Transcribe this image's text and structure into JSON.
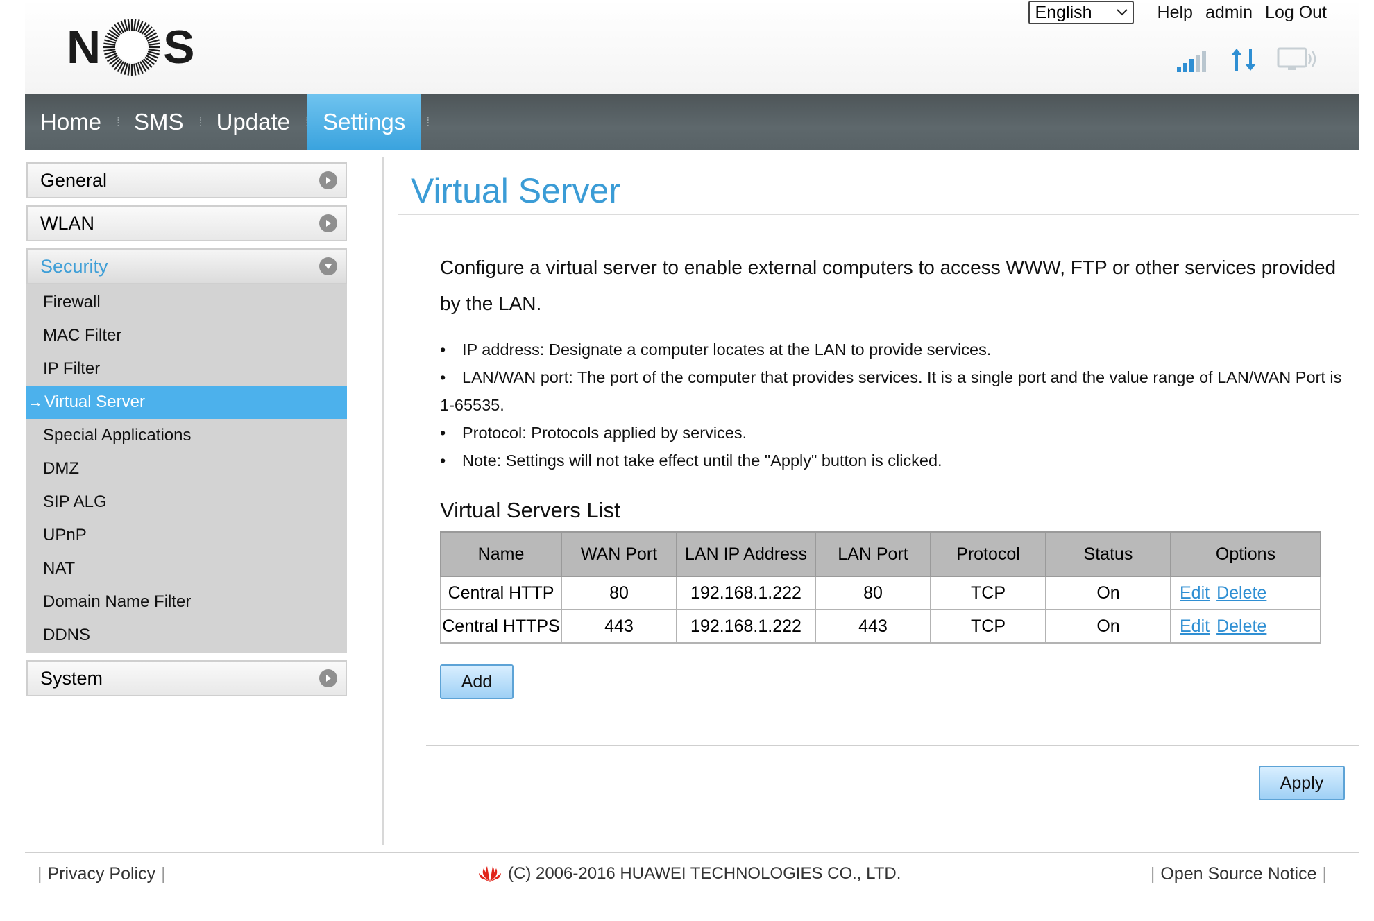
{
  "header": {
    "logo_text_left": "N",
    "logo_text_right": "S",
    "language": "English",
    "links": [
      "Help",
      "admin",
      "Log Out"
    ],
    "status_icons": [
      "signal-strength-icon",
      "data-transfer-icon",
      "pc-connection-icon"
    ]
  },
  "nav": {
    "items": [
      {
        "label": "Home",
        "active": false
      },
      {
        "label": "SMS",
        "active": false
      },
      {
        "label": "Update",
        "active": false
      },
      {
        "label": "Settings",
        "active": true
      }
    ]
  },
  "sidebar": {
    "general": "General",
    "wlan": "WLAN",
    "security": "Security",
    "system": "System",
    "security_items": [
      {
        "label": "Firewall",
        "active": false
      },
      {
        "label": "MAC Filter",
        "active": false
      },
      {
        "label": "IP Filter",
        "active": false
      },
      {
        "label": "Virtual Server",
        "active": true
      },
      {
        "label": "Special Applications",
        "active": false
      },
      {
        "label": "DMZ",
        "active": false
      },
      {
        "label": "SIP ALG",
        "active": false
      },
      {
        "label": "UPnP",
        "active": false
      },
      {
        "label": "NAT",
        "active": false
      },
      {
        "label": "Domain Name Filter",
        "active": false
      },
      {
        "label": "DDNS",
        "active": false
      }
    ]
  },
  "main": {
    "title": "Virtual Server",
    "intro": "Configure a virtual server to enable external computers to access WWW, FTP or other services provided by the LAN.",
    "bullets": [
      "IP address: Designate a computer locates at the LAN to provide services.",
      "LAN/WAN port: The port of the computer that provides services. It is a single port and the value range of LAN/WAN Port is 1-65535.",
      "Protocol: Protocols applied by services.",
      "Note: Settings will not take effect until the \"Apply\" button is clicked."
    ],
    "list_title": "Virtual Servers List",
    "table": {
      "headers": [
        "Name",
        "WAN Port",
        "LAN IP Address",
        "LAN Port",
        "Protocol",
        "Status",
        "Options"
      ],
      "rows": [
        [
          "Central HTTP",
          "80",
          "192.168.1.222",
          "80",
          "TCP",
          "On"
        ],
        [
          "Central HTTPS",
          "443",
          "192.168.1.222",
          "443",
          "TCP",
          "On"
        ]
      ],
      "edit_label": "Edit",
      "delete_label": "Delete"
    },
    "add_label": "Add",
    "apply_label": "Apply"
  },
  "footer": {
    "privacy": "Privacy Policy",
    "copyright": "(C) 2006-2016 HUAWEI TECHNOLOGIES CO., LTD.",
    "open_source": "Open Source Notice"
  },
  "colors": {
    "accent": "#3b9cd6",
    "nav_bg": "#586266",
    "active_tab": "#4cb1ec",
    "sidebar_sub_bg": "#d3d3d3"
  }
}
